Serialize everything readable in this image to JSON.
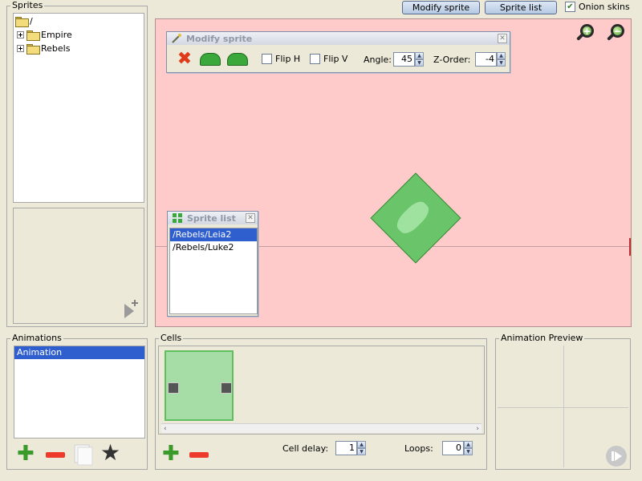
{
  "sprites_panel": {
    "title": "Sprites",
    "tree": [
      {
        "label": "/"
      },
      {
        "label": "Empire"
      },
      {
        "label": "Rebels"
      }
    ]
  },
  "toolbar": {
    "modify_sprite": "Modify sprite",
    "sprite_list": "Sprite list",
    "onion_skins": "Onion skins",
    "onion_checked": true
  },
  "modify_window": {
    "title": "Modify sprite",
    "flip_h": "Flip H",
    "flip_v": "Flip V",
    "angle_label": "Angle:",
    "angle_value": "45",
    "zorder_label": "Z-Order:",
    "zorder_value": "-4"
  },
  "sprite_list_window": {
    "title": "Sprite list",
    "items": [
      "/Rebels/Leia2",
      "/Rebels/Luke2"
    ],
    "selected_index": 0
  },
  "animations_panel": {
    "title": "Animations",
    "items": [
      "Animation"
    ],
    "selected_index": 0
  },
  "cells_panel": {
    "title": "Cells",
    "cell_delay_label": "Cell delay:",
    "cell_delay_value": "1",
    "loops_label": "Loops:",
    "loops_value": "0"
  },
  "preview_panel": {
    "title": "Animation Preview"
  },
  "colors": {
    "canvas_bg": "#ffcaca",
    "selection": "#2f5fcf",
    "sprite_green": "#6ac46a"
  }
}
